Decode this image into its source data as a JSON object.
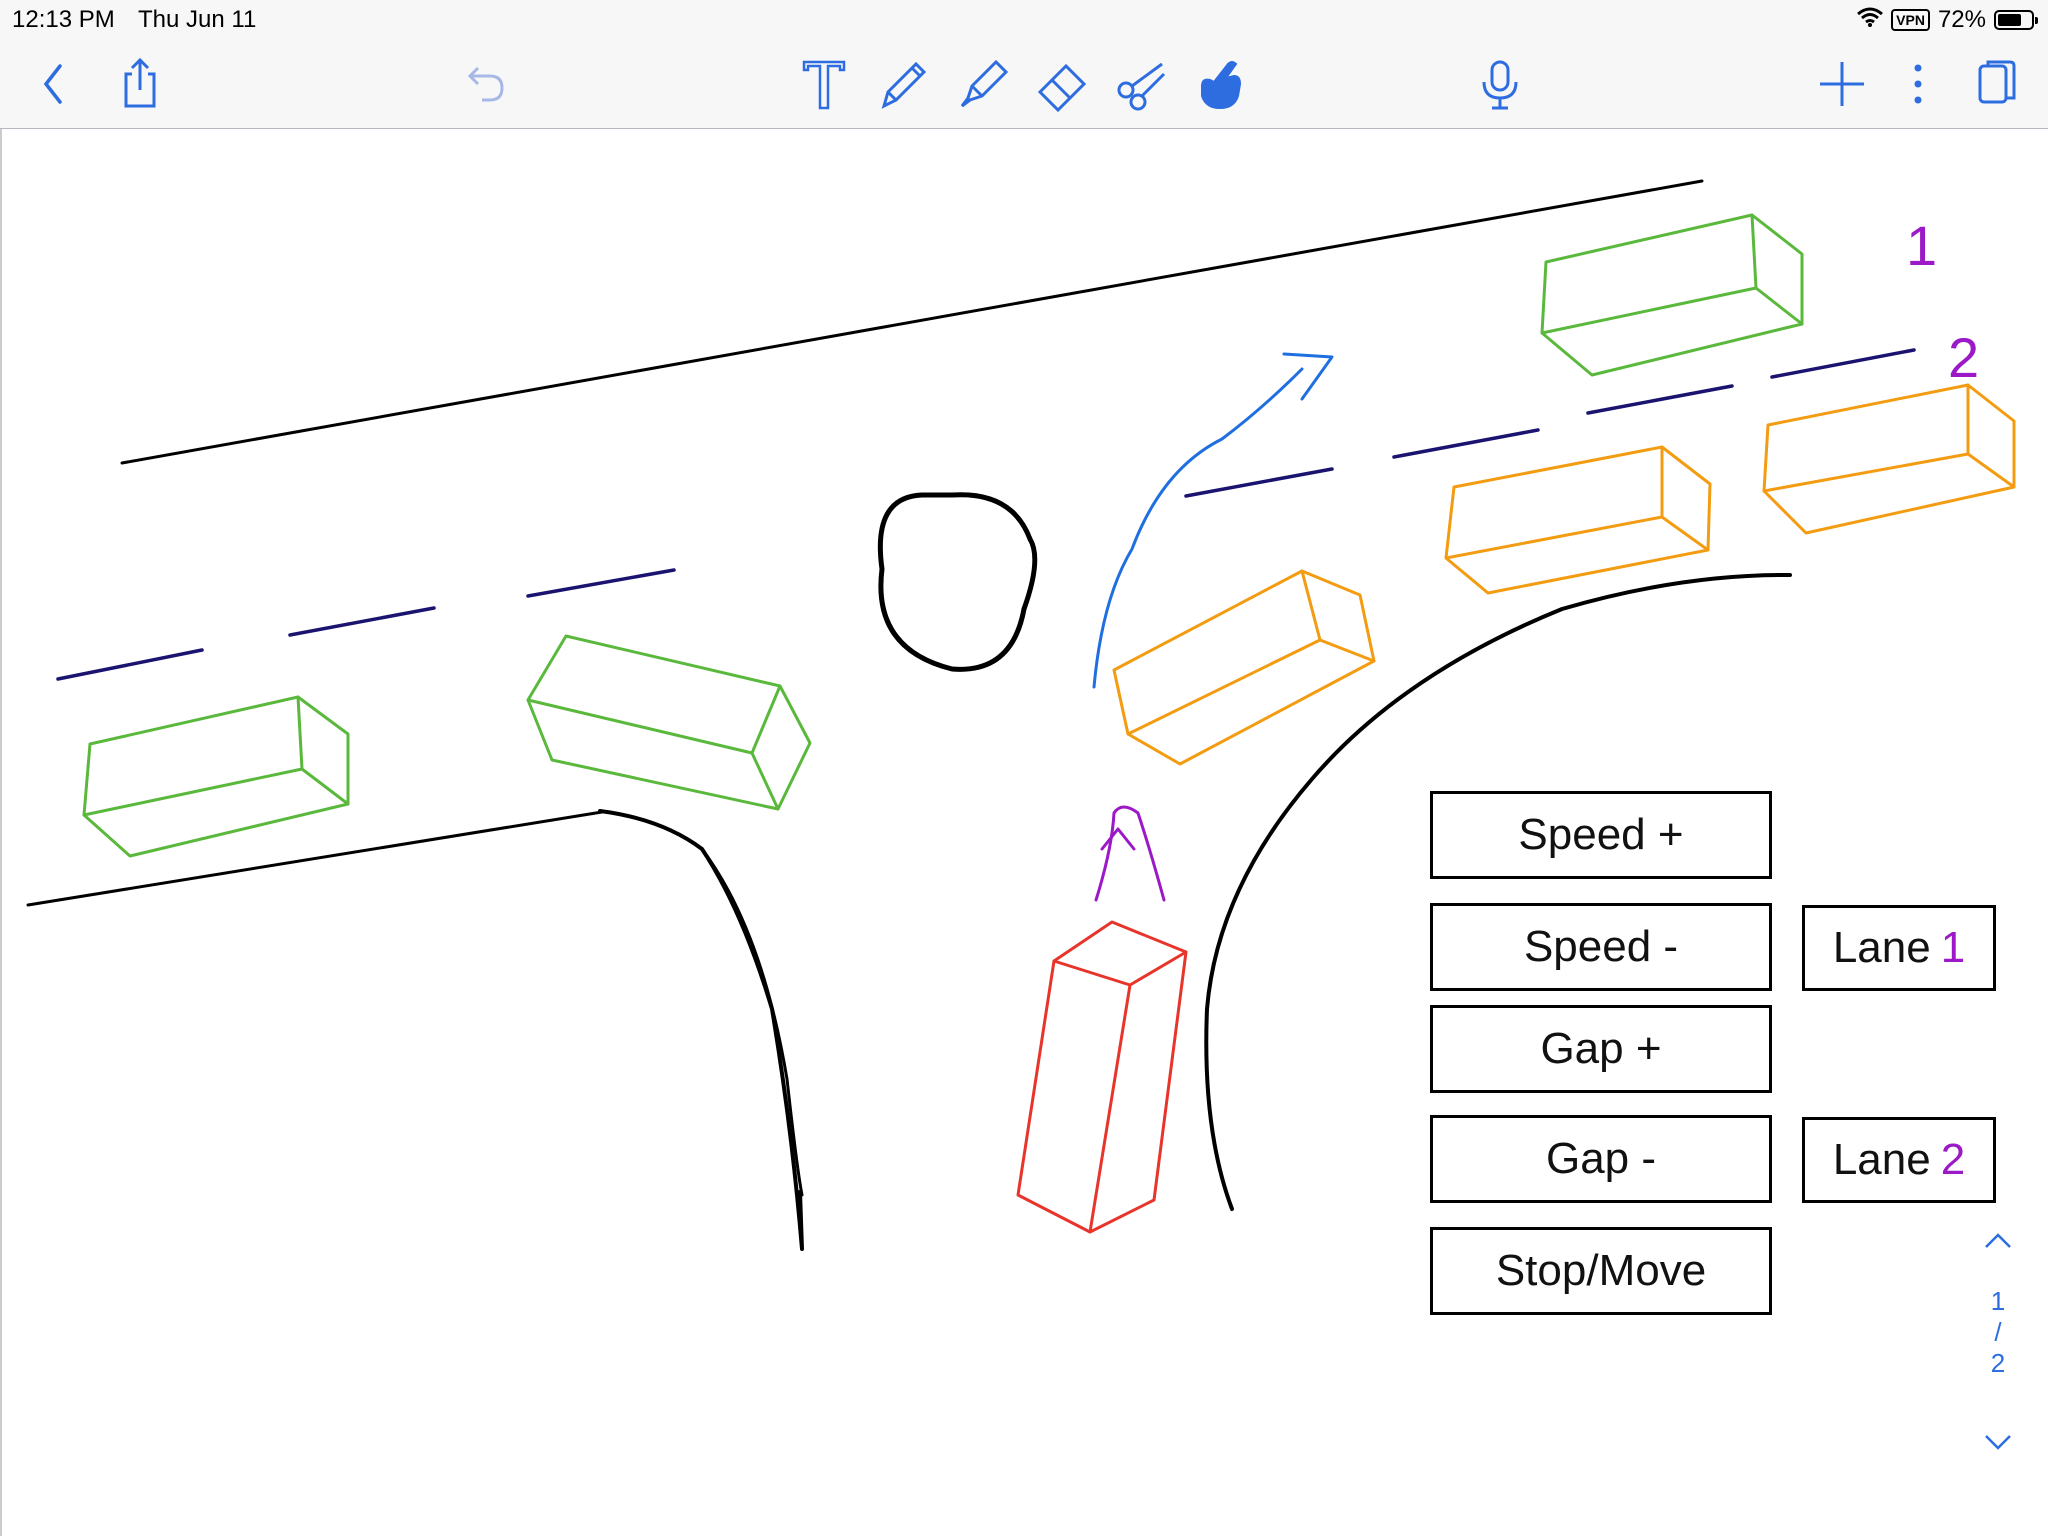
{
  "status": {
    "time": "12:13 PM",
    "date": "Thu Jun 11",
    "vpn": "VPN",
    "battery": "72%",
    "battery_level": 0.72
  },
  "toolbar": {
    "back_icon": "chevron-left-icon",
    "share_icon": "share-icon",
    "undo_icon": "undo-icon",
    "tools": [
      "text-tool-icon",
      "pen-icon",
      "highlighter-icon",
      "eraser-icon",
      "scissors-icon",
      "pointer-hand-icon"
    ],
    "mic_icon": "microphone-icon",
    "add_icon": "plus-icon",
    "more_icon": "more-vertical-icon",
    "pages_icon": "pages-icon",
    "accent": "#2d6de0"
  },
  "canvas": {
    "lane_labels": [
      "1",
      "2"
    ],
    "controls": {
      "speed_plus": "Speed +",
      "speed_minus": "Speed -",
      "gap_plus": "Gap +",
      "gap_minus": "Gap -",
      "stop_move": "Stop/Move",
      "lane1": {
        "text": "Lane",
        "num": "1"
      },
      "lane2": {
        "text": "Lane",
        "num": "2"
      }
    },
    "colors": {
      "road": "#000000",
      "lane_dash": "#1a1470",
      "car_green": "#5ab93c",
      "car_orange": "#f39c12",
      "car_red": "#e8352b",
      "arrow_blue": "#1f6fe0",
      "arrow_purple": "#9b19c6"
    }
  },
  "pager": {
    "current": "1",
    "sep": "/",
    "total": "2"
  }
}
